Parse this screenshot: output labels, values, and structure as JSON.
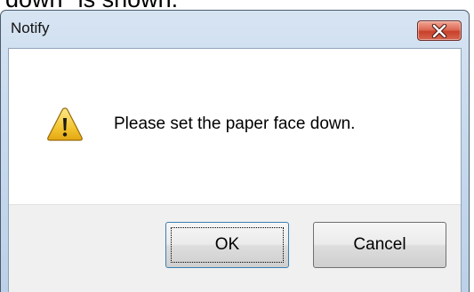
{
  "caption": {
    "text": "down\" is shown."
  },
  "dialog": {
    "title": "Notify",
    "message": "Please set the paper face down.",
    "icons": {
      "close": "close-icon",
      "warning": "warning-icon"
    },
    "buttons": {
      "ok_label": "OK",
      "cancel_label": "Cancel"
    },
    "colors": {
      "titlebar": "#c9dbee",
      "close_button": "#c8412b",
      "warning_fill": "#f3c632",
      "button_bar": "#f0f0f0"
    }
  }
}
